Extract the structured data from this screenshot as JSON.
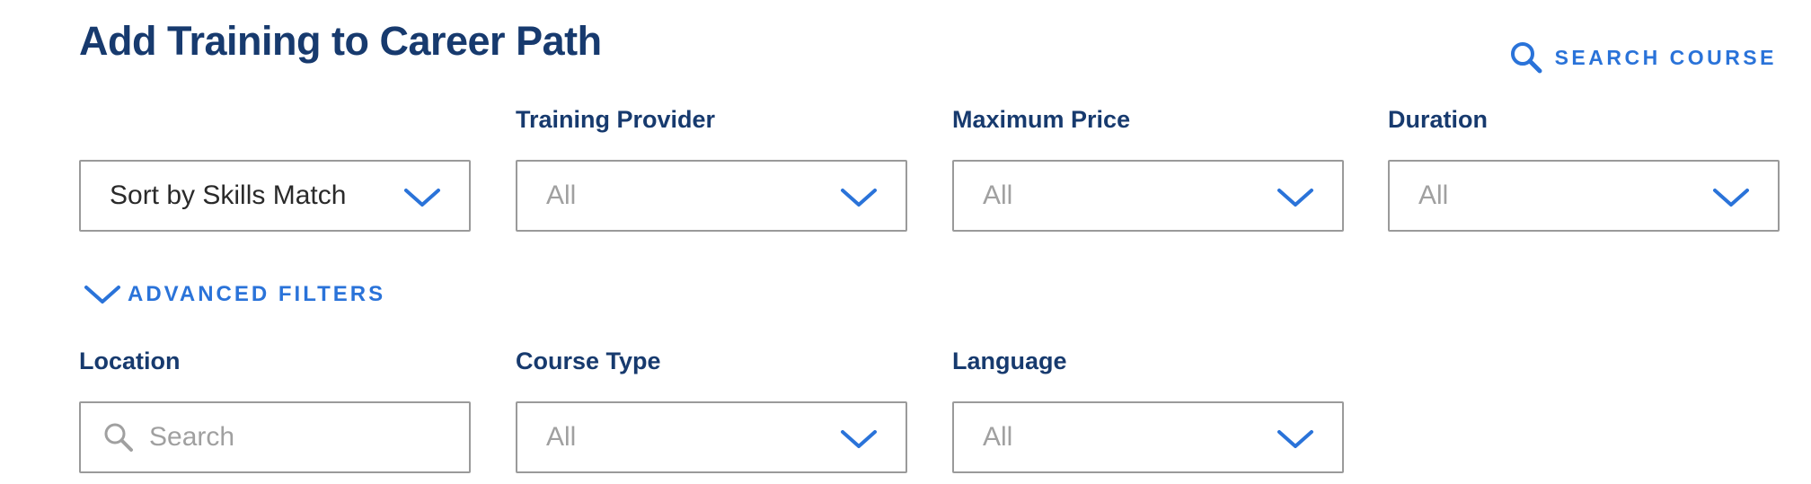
{
  "header": {
    "title": "Add Training to Career Path",
    "search_course_label": "SEARCH COURSE"
  },
  "filters_row1": {
    "sort": {
      "label": "",
      "value": "Sort by Skills Match"
    },
    "training_provider": {
      "label": "Training Provider",
      "value": "All"
    },
    "maximum_price": {
      "label": "Maximum Price",
      "value": "All"
    },
    "duration": {
      "label": "Duration",
      "value": "All"
    }
  },
  "advanced_filters": {
    "label": "ADVANCED FILTERS"
  },
  "filters_row2": {
    "location": {
      "label": "Location",
      "placeholder": "Search"
    },
    "course_type": {
      "label": "Course Type",
      "value": "All"
    },
    "language": {
      "label": "Language",
      "value": "All"
    }
  },
  "icons": {
    "search": "search-icon",
    "dropdown": "chevron-down-icon"
  },
  "colors": {
    "title": "#173a6e",
    "accent": "#2a73d9",
    "border": "#9a9a9a",
    "placeholder": "#a0a0a0"
  }
}
